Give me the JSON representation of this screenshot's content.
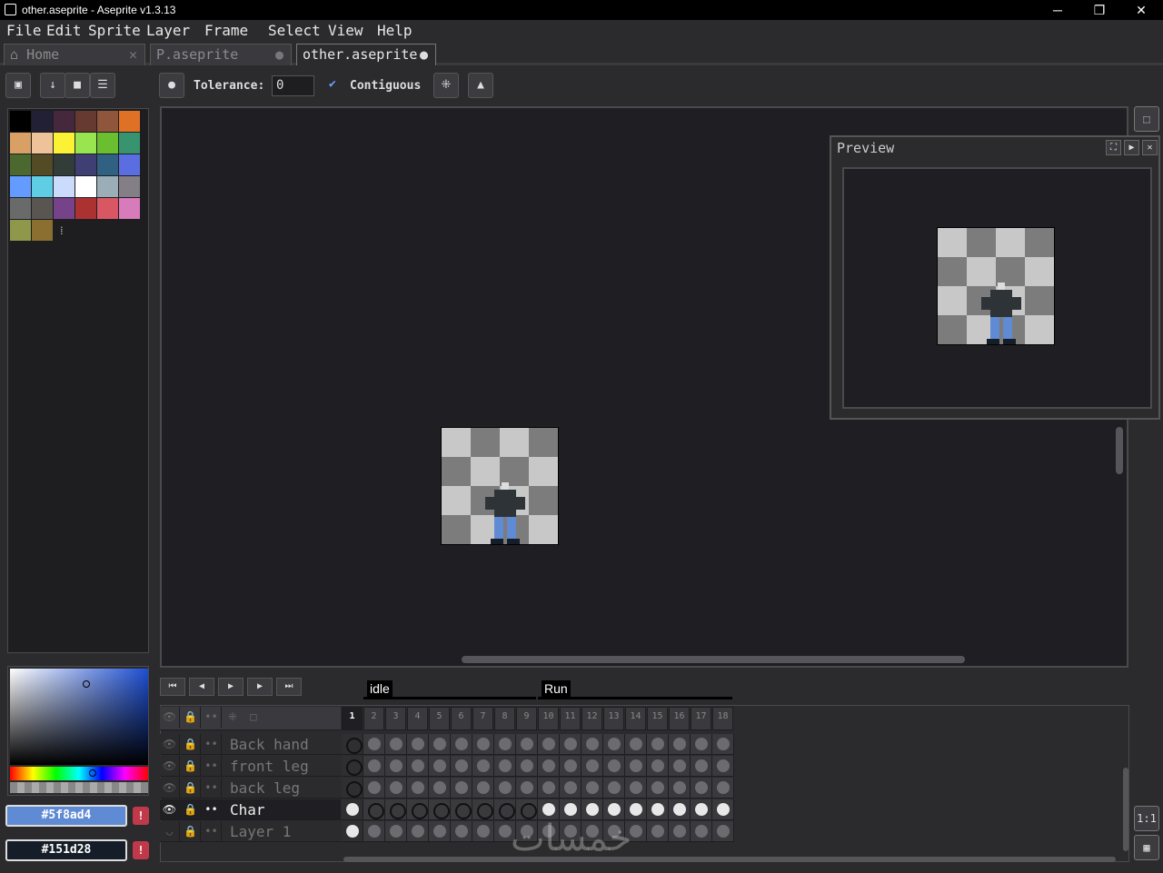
{
  "window": {
    "title": "other.aseprite - Aseprite v1.3.13",
    "min": "─",
    "max": "❐",
    "close": "✕"
  },
  "menu": [
    "File",
    "Edit",
    "Sprite",
    "Layer",
    "Frame",
    "Select",
    "View",
    "Help"
  ],
  "tabs": [
    {
      "label": "Home",
      "icon": "home-icon"
    },
    {
      "label": "P.aseprite"
    },
    {
      "label": "other.aseprite",
      "active": true
    }
  ],
  "toolbar": {
    "tolerance_label": "Tolerance:",
    "tolerance_value": "0",
    "contiguous_label": "Contiguous",
    "contiguous_checked": true
  },
  "palette": [
    "#000000",
    "#222034",
    "#45283c",
    "#663931",
    "#8f563b",
    "#df7126",
    "#d9a066",
    "#eec39a",
    "#fbf236",
    "#99e550",
    "#6abe30",
    "#37946e",
    "#4b692f",
    "#524b24",
    "#323c39",
    "#3f3f74",
    "#306082",
    "#5b6ee1",
    "#639bff",
    "#5fcde4",
    "#cbdbfc",
    "#ffffff",
    "#9badb7",
    "#847e87",
    "#696a6a",
    "#595652",
    "#76428a",
    "#ac3232",
    "#d95763",
    "#d77bba",
    "#8f974a",
    "#8a6f30"
  ],
  "palette_more": "⁞",
  "colors": {
    "foreground": "#5f8ad4",
    "background": "#151d28",
    "warn": "!"
  },
  "preview": {
    "title": "Preview"
  },
  "tags": [
    {
      "name": "idle"
    },
    {
      "name": "Run"
    }
  ],
  "frames": [
    "1",
    "2",
    "3",
    "4",
    "5",
    "6",
    "7",
    "8",
    "9",
    "10",
    "11",
    "12",
    "13",
    "14",
    "15",
    "16",
    "17",
    "18"
  ],
  "layers": [
    {
      "name": "Back hand"
    },
    {
      "name": "front leg"
    },
    {
      "name": "back leg"
    },
    {
      "name": "Char",
      "active": true
    },
    {
      "name": "Layer 1"
    }
  ],
  "watermark": "خمسات"
}
